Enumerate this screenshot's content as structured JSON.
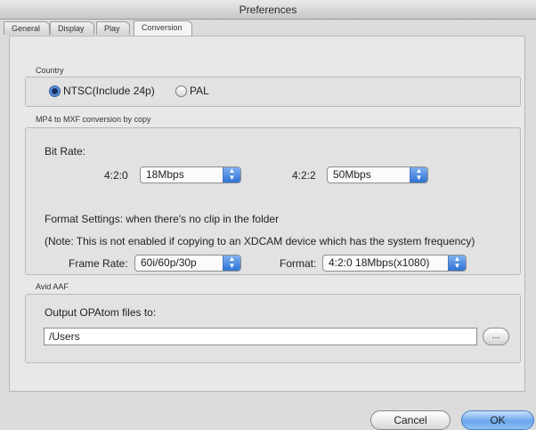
{
  "window": {
    "title": "Preferences"
  },
  "tabs": [
    {
      "label": "General"
    },
    {
      "label": "Display"
    },
    {
      "label": "Play"
    },
    {
      "label": "Conversion",
      "active": true
    }
  ],
  "country": {
    "label": "Country",
    "options": [
      {
        "label": "NTSC(Include 24p)",
        "checked": true
      },
      {
        "label": "PAL",
        "checked": false
      }
    ]
  },
  "mp4": {
    "label": "MP4 to MXF conversion by copy",
    "bit_rate_label": "Bit Rate:",
    "r420_label": "4:2:0",
    "r420_value": "18Mbps",
    "r422_label": "4:2:2",
    "r422_value": "50Mbps",
    "format_settings": "Format Settings: when there's no clip in the folder",
    "note": "(Note: This is not enabled if copying to an XDCAM device which has the system frequency)",
    "frame_rate_label": "Frame Rate:",
    "frame_rate_value": "60i/60p/30p",
    "format_label": "Format:",
    "format_value": "4:2:0 18Mbps(x1080)"
  },
  "avid": {
    "label": "Avid AAF",
    "output_label": "Output OPAtom files to:",
    "path": "/Users",
    "browse_label": "..."
  },
  "buttons": {
    "cancel": "Cancel",
    "ok": "OK"
  },
  "colors": {
    "accent": "#4a8fe3",
    "panel": "#e8e8e8"
  }
}
